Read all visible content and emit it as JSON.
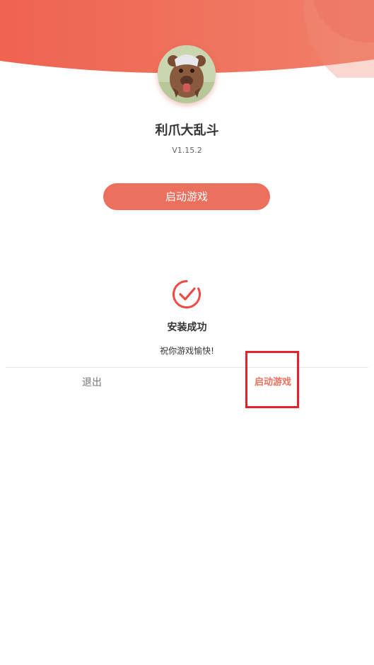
{
  "colors": {
    "accent": "#ec705e",
    "header_gradient_start": "#ef6350",
    "header_gradient_end": "#f28a72",
    "highlight_box": "#e8202b",
    "success_icon": "#ec4a45"
  },
  "app": {
    "name": "利爪大乱斗",
    "version": "V1.15.2",
    "avatar_icon": "bear-character-icon"
  },
  "primary_button": {
    "label": "启动游戏"
  },
  "success": {
    "icon": "check-circle-icon",
    "title": "安装成功",
    "message": "祝你游戏愉快!"
  },
  "footer": {
    "exit_label": "退出",
    "launch_label": "启动游戏"
  }
}
